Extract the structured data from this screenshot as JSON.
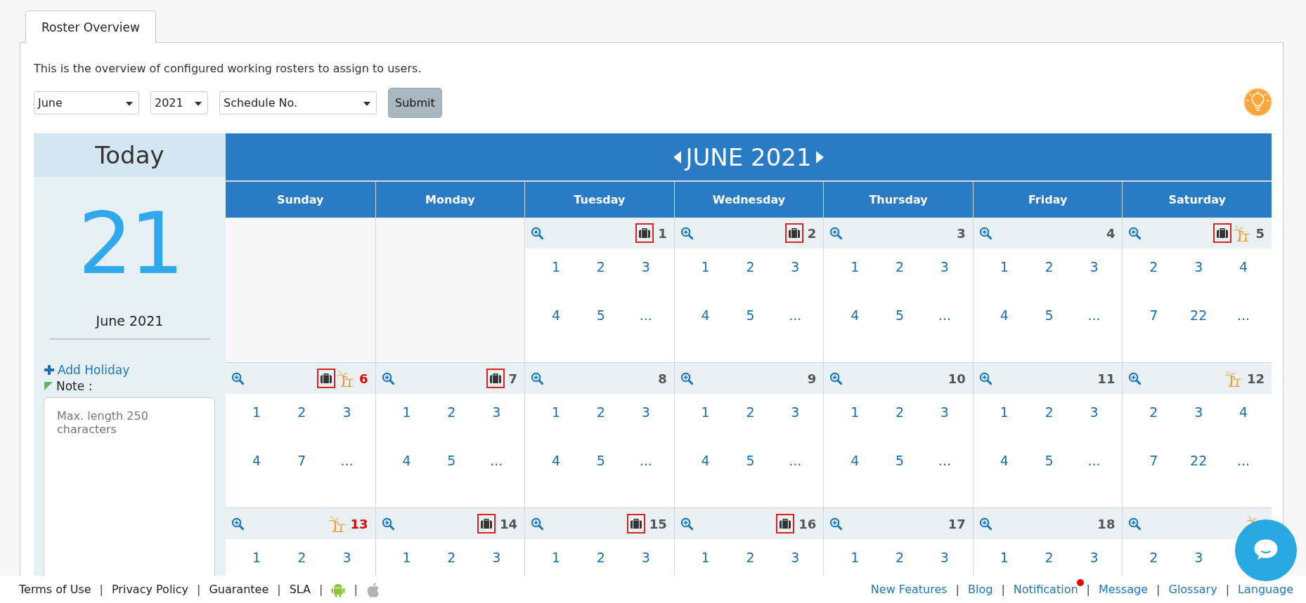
{
  "tabs": [
    {
      "label": "Roster Overview",
      "selected": true
    }
  ],
  "description": "This is the overview of configured working rosters to assign to users.",
  "filters": {
    "month": "June",
    "year": "2021",
    "schedule": "Schedule No.",
    "submit": "Submit"
  },
  "today": {
    "title": "Today",
    "day": "21",
    "month_year": "June 2021",
    "add_holiday": "Add Holiday",
    "note_label": "Note :",
    "note_placeholder": "Max. length 250 characters"
  },
  "calendar": {
    "title": "JUNE 2021",
    "weekdays": [
      "Sunday",
      "Monday",
      "Tuesday",
      "Wednesday",
      "Thursday",
      "Friday",
      "Saturday"
    ],
    "weeks": [
      [
        {
          "kind": "empty"
        },
        {
          "kind": "empty"
        },
        {
          "kind": "day",
          "day": "1",
          "briefcase": true,
          "holiday": false,
          "red": false,
          "values": [
            "1",
            "2",
            "3",
            "4",
            "5",
            "..."
          ]
        },
        {
          "kind": "day",
          "day": "2",
          "briefcase": true,
          "holiday": false,
          "red": false,
          "values": [
            "1",
            "2",
            "3",
            "4",
            "5",
            "..."
          ]
        },
        {
          "kind": "day",
          "day": "3",
          "briefcase": false,
          "holiday": false,
          "red": false,
          "values": [
            "1",
            "2",
            "3",
            "4",
            "5",
            "..."
          ]
        },
        {
          "kind": "day",
          "day": "4",
          "briefcase": false,
          "holiday": false,
          "red": false,
          "values": [
            "1",
            "2",
            "3",
            "4",
            "5",
            "..."
          ]
        },
        {
          "kind": "day",
          "day": "5",
          "briefcase": true,
          "holiday": true,
          "red": false,
          "values": [
            "2",
            "3",
            "4",
            "7",
            "22",
            "..."
          ]
        }
      ],
      [
        {
          "kind": "day",
          "day": "6",
          "briefcase": true,
          "holiday": true,
          "red": true,
          "values": [
            "1",
            "2",
            "3",
            "4",
            "7",
            "..."
          ]
        },
        {
          "kind": "day",
          "day": "7",
          "briefcase": true,
          "holiday": false,
          "red": false,
          "values": [
            "1",
            "2",
            "3",
            "4",
            "5",
            "..."
          ]
        },
        {
          "kind": "day",
          "day": "8",
          "briefcase": false,
          "holiday": false,
          "red": false,
          "values": [
            "1",
            "2",
            "3",
            "4",
            "5",
            "..."
          ]
        },
        {
          "kind": "day",
          "day": "9",
          "briefcase": false,
          "holiday": false,
          "red": false,
          "values": [
            "1",
            "2",
            "3",
            "4",
            "5",
            "..."
          ]
        },
        {
          "kind": "day",
          "day": "10",
          "briefcase": false,
          "holiday": false,
          "red": false,
          "values": [
            "1",
            "2",
            "3",
            "4",
            "5",
            "..."
          ]
        },
        {
          "kind": "day",
          "day": "11",
          "briefcase": false,
          "holiday": false,
          "red": false,
          "values": [
            "1",
            "2",
            "3",
            "4",
            "5",
            "..."
          ]
        },
        {
          "kind": "day",
          "day": "12",
          "briefcase": false,
          "holiday": true,
          "red": false,
          "values": [
            "2",
            "3",
            "4",
            "7",
            "22",
            "..."
          ]
        }
      ],
      [
        {
          "kind": "day",
          "day": "13",
          "briefcase": false,
          "holiday": true,
          "red": true,
          "values": [
            "1",
            "2",
            "3"
          ]
        },
        {
          "kind": "day",
          "day": "14",
          "briefcase": true,
          "holiday": false,
          "red": false,
          "values": [
            "1",
            "2",
            "3"
          ]
        },
        {
          "kind": "day",
          "day": "15",
          "briefcase": true,
          "holiday": false,
          "red": false,
          "values": [
            "1",
            "2",
            "3"
          ]
        },
        {
          "kind": "day",
          "day": "16",
          "briefcase": true,
          "holiday": false,
          "red": false,
          "values": [
            "1",
            "2",
            "3"
          ]
        },
        {
          "kind": "day",
          "day": "17",
          "briefcase": false,
          "holiday": false,
          "red": false,
          "values": [
            "1",
            "2",
            "3"
          ]
        },
        {
          "kind": "day",
          "day": "18",
          "briefcase": false,
          "holiday": false,
          "red": false,
          "values": [
            "1",
            "2",
            "3"
          ]
        },
        {
          "kind": "day",
          "briefcase": false,
          "holiday": true,
          "values": [
            "2",
            "3"
          ]
        }
      ]
    ]
  },
  "footer": {
    "separator": "|",
    "left": [
      {
        "kind": "link",
        "label": "Terms of Use"
      },
      {
        "kind": "link",
        "label": "Privacy Policy"
      },
      {
        "kind": "link",
        "label": "Guarantee"
      },
      {
        "kind": "link",
        "label": "SLA"
      },
      {
        "kind": "android"
      },
      {
        "kind": "apple"
      }
    ],
    "right": [
      {
        "label": "New Features",
        "badge": false
      },
      {
        "label": "Blog",
        "badge": false
      },
      {
        "label": "Notification",
        "badge": true
      },
      {
        "label": "Message",
        "badge": false
      },
      {
        "label": "Glossary",
        "badge": false
      },
      {
        "label": "Language",
        "badge": false
      }
    ]
  }
}
